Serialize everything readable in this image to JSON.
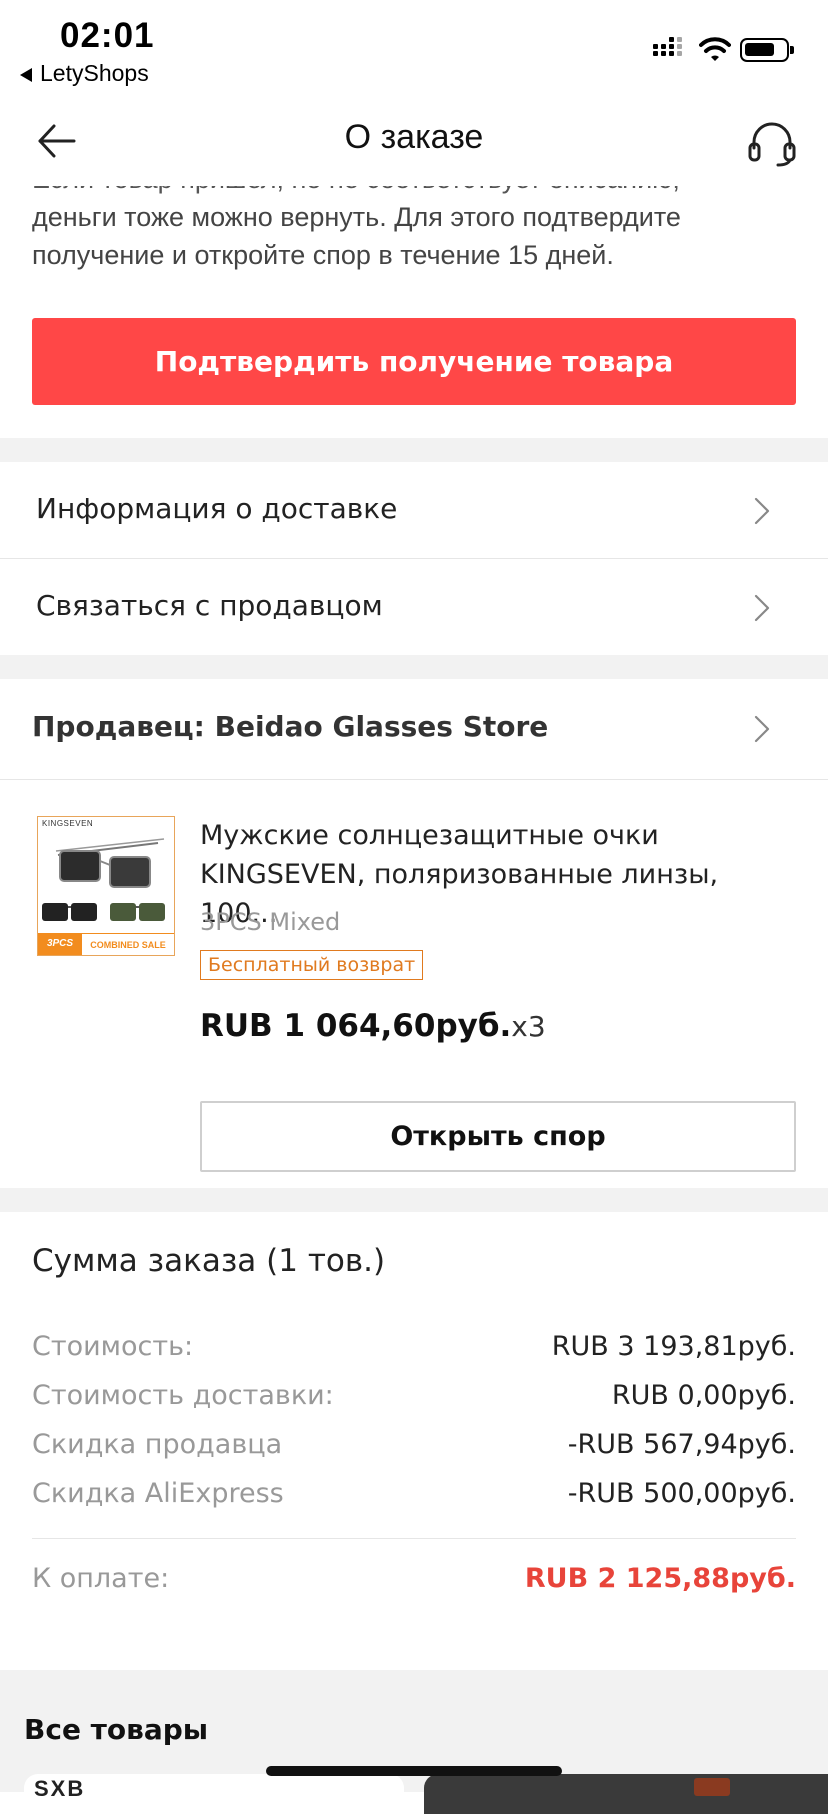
{
  "status_bar": {
    "time": "02:01",
    "back_app": "LetyShops"
  },
  "header": {
    "title": "О заказе",
    "back_icon": "arrow-left-icon",
    "support_icon": "headset-icon"
  },
  "notice": {
    "line1": "Если товар пришел, но не соответствует описанию,",
    "line2": "деньги тоже можно вернуть. Для этого подтвердите",
    "line3": "получение и откройте спор в течение 15 дней."
  },
  "confirm_button": "Подтвердить получение товара",
  "menu": {
    "delivery_info": "Информация о доставке",
    "contact_seller": "Связаться с продавцом"
  },
  "seller": {
    "label": "Продавец: Beidao Glasses Store"
  },
  "product": {
    "thumbnail": {
      "brand": "KINGSEVEN",
      "tag_left": "3PCS",
      "tag_right": "COMBINED SALE"
    },
    "title": "Мужские солнцезащитные очки KINGSEVEN, поляризованные линзы, 100...",
    "variant": "3PCS Mixed",
    "badge": "Бесплатный возврат",
    "price": "RUB 1 064,60руб.",
    "quantity": "x3",
    "dispute_button": "Открыть спор"
  },
  "summary": {
    "title": "Сумма заказа (1 тов.)",
    "rows": [
      {
        "label": "Стоимость:",
        "value": "RUB 3 193,81руб."
      },
      {
        "label": "Стоимость доставки:",
        "value": "RUB 0,00руб."
      },
      {
        "label": "Скидка продавца",
        "value": "-RUB 567,94руб."
      },
      {
        "label": "Скидка AliExpress",
        "value": "-RUB 500,00руб."
      }
    ],
    "total_label": "К оплате:",
    "total_value": "RUB 2 125,88руб."
  },
  "all_products": {
    "title": "Все товары",
    "card_logo": "SXB"
  },
  "colors": {
    "accent": "#ff4747",
    "total": "#e8443a",
    "badge": "#e07a1f"
  }
}
